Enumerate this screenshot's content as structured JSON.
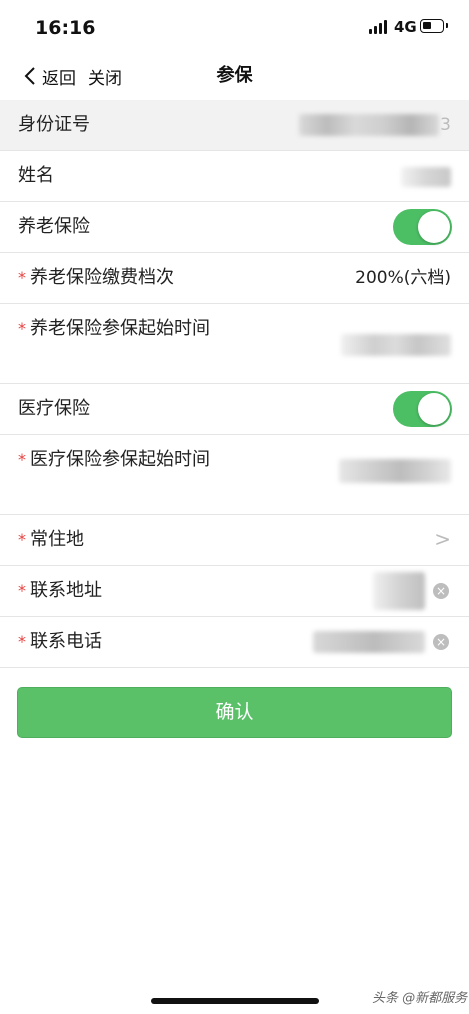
{
  "status_bar": {
    "time": "16:16",
    "network": "4G"
  },
  "nav": {
    "back_label": "返回",
    "close_label": "关闭",
    "title": "参保"
  },
  "form": {
    "id_number": {
      "label": "身份证号",
      "value_suffix": "3"
    },
    "name": {
      "label": "姓名"
    },
    "pension_insurance": {
      "label": "养老保险",
      "enabled": true
    },
    "pension_contribution_level": {
      "required_mark": "*",
      "label": "养老保险缴费档次",
      "value": "200%(六档)"
    },
    "pension_start_time": {
      "required_mark": "*",
      "label": "养老保险参保起始时间"
    },
    "medical_insurance": {
      "label": "医疗保险",
      "enabled": true
    },
    "medical_start_time": {
      "required_mark": "*",
      "label": "医疗保险参保起始时间"
    },
    "residence": {
      "required_mark": "*",
      "label": "常住地",
      "chevron": ">"
    },
    "contact_address": {
      "required_mark": "*",
      "label": "联系地址"
    },
    "contact_phone": {
      "required_mark": "*",
      "label": "联系电话"
    }
  },
  "confirm_button": {
    "label": "确认"
  },
  "watermark": "头条 @新都服务",
  "colors": {
    "accent": "#5ac169",
    "toggle_on": "#4cbf65",
    "required": "#e64340"
  }
}
